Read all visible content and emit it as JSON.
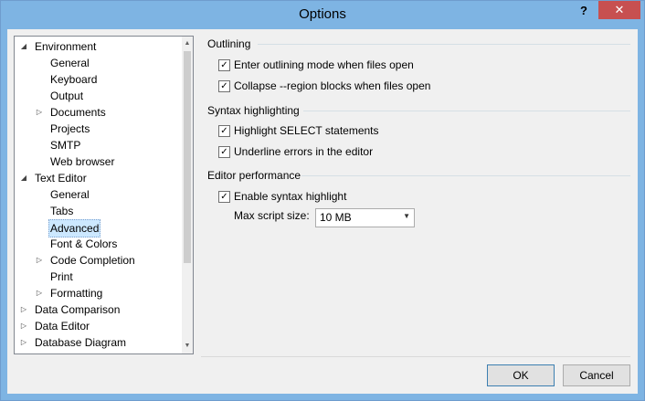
{
  "window": {
    "title": "Options",
    "help_label": "?",
    "close_label": "✕"
  },
  "tree": {
    "items": [
      {
        "label": "Environment",
        "expander": "open"
      },
      {
        "label": "General"
      },
      {
        "label": "Keyboard"
      },
      {
        "label": "Output"
      },
      {
        "label": "Documents",
        "expander": "closed"
      },
      {
        "label": "Projects"
      },
      {
        "label": "SMTP"
      },
      {
        "label": "Web browser"
      },
      {
        "label": "Text Editor",
        "expander": "open"
      },
      {
        "label": "General"
      },
      {
        "label": "Tabs"
      },
      {
        "label": "Advanced",
        "selected": true
      },
      {
        "label": "Font & Colors"
      },
      {
        "label": "Code Completion",
        "expander": "closed"
      },
      {
        "label": "Print"
      },
      {
        "label": "Formatting",
        "expander": "closed"
      },
      {
        "label": "Data Comparison",
        "expander": "closed"
      },
      {
        "label": "Data Editor",
        "expander": "closed"
      },
      {
        "label": "Database Diagram",
        "expander": "closed"
      }
    ]
  },
  "sections": {
    "outlining": {
      "header": "Outlining",
      "enter_outlining": {
        "label": "Enter outlining mode when files open",
        "checked": true
      },
      "collapse_region": {
        "label": "Collapse --region blocks when files open",
        "checked": true
      }
    },
    "syntax": {
      "header": "Syntax highlighting",
      "highlight_select": {
        "label": "Highlight SELECT statements",
        "checked": true
      },
      "underline_errors": {
        "label": "Underline errors in the editor",
        "checked": true
      }
    },
    "performance": {
      "header": "Editor performance",
      "enable_syntax": {
        "label": "Enable syntax highlight",
        "checked": true
      },
      "max_script_label": "Max script size:",
      "max_script_value": "10 MB"
    }
  },
  "buttons": {
    "ok": "OK",
    "cancel": "Cancel"
  },
  "icons": {
    "expander_open": "◢",
    "expander_closed": "▷",
    "check": "✓",
    "dropdown_arrow": "▼",
    "scroll_up": "▲",
    "scroll_down": "▼"
  },
  "colors": {
    "titlebar": "#7eb4e3",
    "close": "#c75050",
    "selection": "#cce8ff"
  }
}
